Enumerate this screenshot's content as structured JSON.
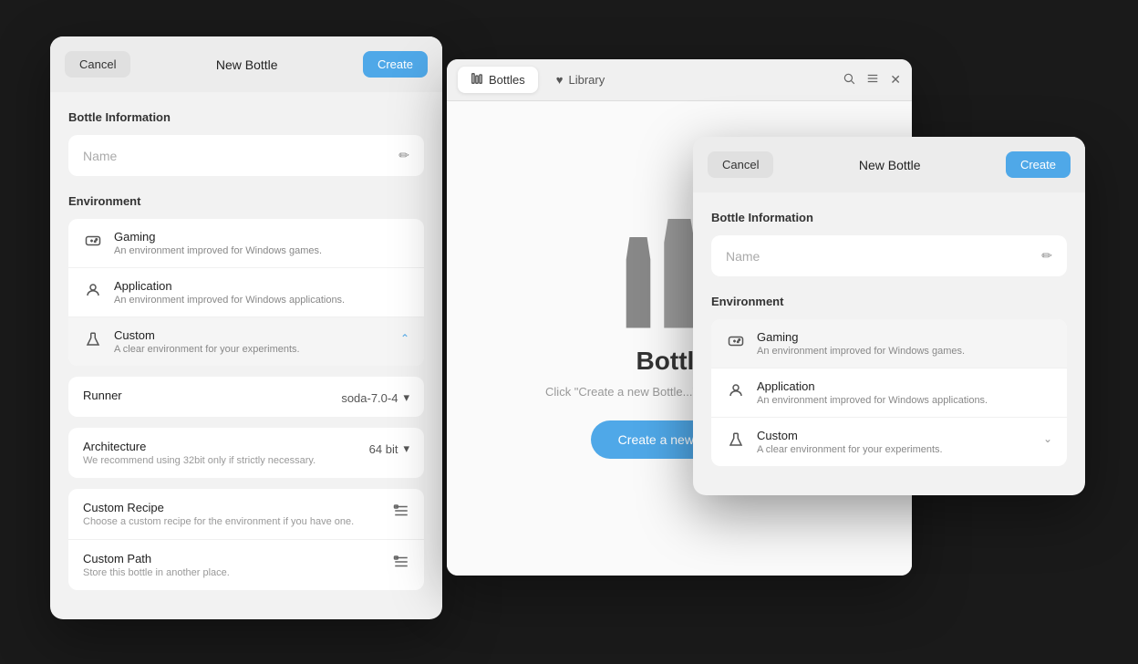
{
  "left_dialog": {
    "cancel_label": "Cancel",
    "title": "New Bottle",
    "create_label": "Create",
    "bottle_info_title": "Bottle Information",
    "name_placeholder": "Name",
    "environment_title": "Environment",
    "environments": [
      {
        "id": "gaming",
        "name": "Gaming",
        "desc": "An environment improved for Windows games.",
        "icon": "gamepad"
      },
      {
        "id": "application",
        "name": "Application",
        "desc": "An environment improved for Windows applications.",
        "icon": "app"
      },
      {
        "id": "custom",
        "name": "Custom",
        "desc": "A clear environment for your experiments.",
        "icon": "flask",
        "selected": true,
        "chevron": "up"
      }
    ],
    "runner_label": "Runner",
    "runner_value": "soda-7.0-4",
    "architecture_label": "Architecture",
    "architecture_sublabel": "We recommend using 32bit only if strictly necessary.",
    "architecture_value": "64 bit",
    "custom_recipe_label": "Custom Recipe",
    "custom_recipe_sublabel": "Choose a custom recipe for the environment if you have one.",
    "custom_path_label": "Custom Path",
    "custom_path_sublabel": "Store this bottle in another place."
  },
  "main_window": {
    "tab_bottles_label": "Bottles",
    "tab_library_label": "Library",
    "bottles_icon": "bar-chart",
    "library_icon": "heart",
    "bottles_title": "Bottles",
    "bottles_desc": "Click \"Create a new Bottle...\" to create a new bottle",
    "create_bottle_btn": "Create a new Bottle..."
  },
  "right_dialog": {
    "cancel_label": "Cancel",
    "title": "New Bottle",
    "create_label": "Create",
    "bottle_info_title": "Bottle Information",
    "name_placeholder": "Name",
    "environment_title": "Environment",
    "environments": [
      {
        "id": "gaming",
        "name": "Gaming",
        "desc": "An environment improved for Windows games.",
        "icon": "gamepad",
        "selected": true
      },
      {
        "id": "application",
        "name": "Application",
        "desc": "An environment improved for Windows applications.",
        "icon": "app"
      },
      {
        "id": "custom",
        "name": "Custom",
        "desc": "A clear environment for your experiments.",
        "icon": "flask",
        "chevron": "down"
      }
    ]
  }
}
